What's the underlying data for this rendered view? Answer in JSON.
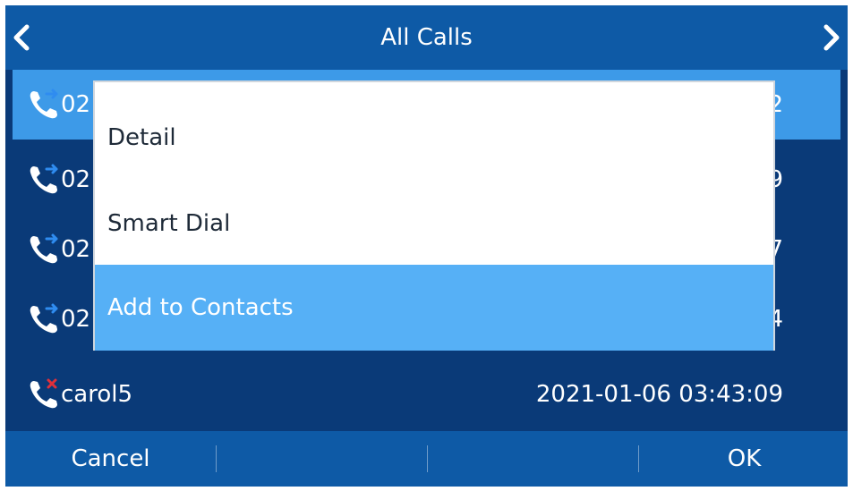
{
  "header": {
    "title": "All Calls"
  },
  "calls": [
    {
      "number_visible": "02",
      "time_visible": "2",
      "type": "outgoing",
      "selected": true
    },
    {
      "number_visible": "02",
      "time_visible": "9",
      "type": "outgoing",
      "selected": false
    },
    {
      "number_visible": "02",
      "time_visible": "7",
      "type": "outgoing",
      "selected": false
    },
    {
      "number_visible": "02",
      "time_visible": "4",
      "type": "outgoing",
      "selected": false
    },
    {
      "number_visible": "carol5",
      "time_visible": "2021-01-06 03:43:09",
      "type": "missed",
      "selected": false
    }
  ],
  "menu": {
    "items": [
      "Detail",
      "Smart Dial",
      "Add to Contacts"
    ],
    "active_index": 2
  },
  "softkeys": {
    "left": "Cancel",
    "mid1": "",
    "mid2": "",
    "right": "OK"
  },
  "colors": {
    "background": "#0a3a78",
    "bar": "#0e5aa6",
    "row_selected": "#3d9ae8",
    "menu_active": "#56b0f6",
    "missed": "#e0303a",
    "outgoing_arrow": "#2f8cf0"
  },
  "icons": {
    "back": "chevron-left-icon",
    "forward": "chevron-right-icon",
    "outgoing": "outgoing-call-icon",
    "missed": "missed-call-icon"
  }
}
